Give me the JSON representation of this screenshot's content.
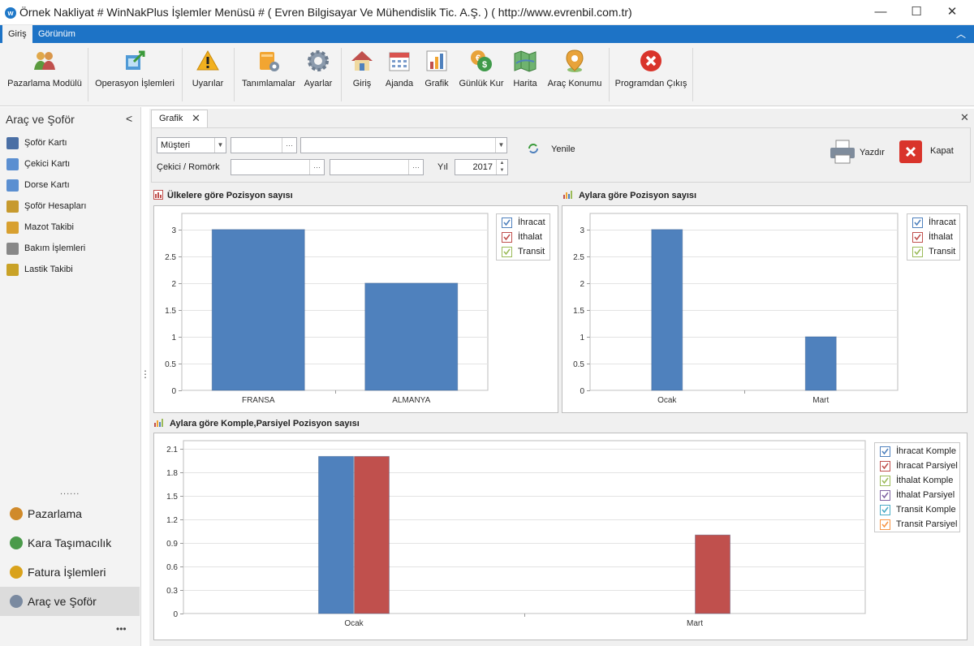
{
  "window": {
    "title": "Örnek Nakliyat # WinNakPlus İşlemler Menüsü #  ( Evren Bilgisayar Ve Mühendislik Tic. A.Ş. ) ( http://www.evrenbil.com.tr)",
    "app_icon_glyph": "w",
    "minimize": "—",
    "maximize": "☐",
    "close": "✕"
  },
  "ribbon": {
    "tabs": [
      "Giriş",
      "Görünüm"
    ],
    "collapse_glyph": "︿",
    "buttons": [
      {
        "label": "Pazarlama Modülü",
        "icon": "users-icon"
      },
      {
        "label": "Operasyon İşlemleri",
        "icon": "export-icon"
      },
      {
        "label": "Uyarılar",
        "icon": "warning-icon"
      },
      {
        "label": "Tanımlamalar",
        "icon": "definitions-icon"
      },
      {
        "label": "Ayarlar",
        "icon": "gear-icon"
      },
      {
        "label": "Giriş",
        "icon": "home-icon"
      },
      {
        "label": "Ajanda",
        "icon": "calendar-icon"
      },
      {
        "label": "Grafik",
        "icon": "chart-icon"
      },
      {
        "label": "Günlük Kur",
        "icon": "currency-icon"
      },
      {
        "label": "Harita",
        "icon": "map-icon"
      },
      {
        "label": "Araç Konumu",
        "icon": "location-pin-icon"
      },
      {
        "label": "Programdan Çıkış",
        "icon": "exit-icon"
      }
    ]
  },
  "left_panel": {
    "title": "Araç ve Şoför",
    "collapse_glyph": "<",
    "items": [
      {
        "label": "Şoför Kartı",
        "color": "#4a6fa5"
      },
      {
        "label": "Çekici Kartı",
        "color": "#5b8fd1"
      },
      {
        "label": "Dorse Kartı",
        "color": "#5b8fd1"
      },
      {
        "label": "Şoför Hesapları",
        "color": "#c79a2e"
      },
      {
        "label": "Mazot Takibi",
        "color": "#d8a030"
      },
      {
        "label": "Bakım İşlemleri",
        "color": "#888888"
      },
      {
        "label": "Lastik Takibi",
        "color": "#c9a227"
      }
    ],
    "splitter_dots": "......",
    "splitter_grip": "⋮",
    "nav": [
      {
        "label": "Pazarlama",
        "color": "#d08a2a"
      },
      {
        "label": "Kara Taşımacılık",
        "color": "#4a9a4a"
      },
      {
        "label": "Fatura İşlemleri",
        "color": "#d9a21b"
      },
      {
        "label": "Araç ve Şoför",
        "color": "#7a8aa0"
      }
    ],
    "more_glyph": "•••"
  },
  "document": {
    "tab_label": "Grafik",
    "tab_close": "✕",
    "close_all": "✕"
  },
  "filters": {
    "customer_combo": "Müşteri",
    "dropdown_glyph": "▼",
    "ellipsis": "···",
    "vehicle_label": "Çekici / Romörk",
    "year_label": "Yıl",
    "year_value": "2017",
    "refresh_label": "Yenile",
    "print_label": "Yazdır",
    "close_label": "Kapat"
  },
  "charts": {
    "country": {
      "title": "Ülkelere göre Pozisyon sayısı",
      "legend": [
        {
          "name": "İhracat",
          "color": "#4f81bd"
        },
        {
          "name": "İthalat",
          "color": "#c0504d"
        },
        {
          "name": "Transit",
          "color": "#9bbb59"
        }
      ]
    },
    "month": {
      "title": "Aylara göre Pozisyon sayısı",
      "legend": [
        {
          "name": "İhracat",
          "color": "#4f81bd"
        },
        {
          "name": "İthalat",
          "color": "#c0504d"
        },
        {
          "name": "Transit",
          "color": "#9bbb59"
        }
      ]
    },
    "split": {
      "title": "Aylara göre Komple,Parsiyel Pozisyon sayısı",
      "legend": [
        {
          "name": "İhracat Komple",
          "color": "#4f81bd"
        },
        {
          "name": "İhracat Parsiyel",
          "color": "#c0504d"
        },
        {
          "name": "İthalat Komple",
          "color": "#9bbb59"
        },
        {
          "name": "İthalat Parsiyel",
          "color": "#8064a2"
        },
        {
          "name": "Transit Komple",
          "color": "#4bacc6"
        },
        {
          "name": "Transit Parsiyel",
          "color": "#f79646"
        }
      ]
    }
  },
  "chart_data": [
    {
      "type": "bar",
      "title": "Ülkelere göre Pozisyon sayısı",
      "categories": [
        "FRANSA",
        "ALMANYA"
      ],
      "series": [
        {
          "name": "İhracat",
          "values": [
            3,
            2
          ],
          "color": "#4f81bd"
        }
      ],
      "yticks": [
        "0",
        "0.5",
        "1",
        "1.5",
        "2",
        "2.5",
        "3"
      ],
      "ylim": [
        0,
        3.3
      ],
      "grid": true,
      "legend_position": "top-right"
    },
    {
      "type": "bar",
      "title": "Aylara göre Pozisyon sayısı",
      "categories": [
        "Ocak",
        "Mart"
      ],
      "series": [
        {
          "name": "İhracat",
          "values": [
            3,
            1
          ],
          "color": "#4f81bd"
        }
      ],
      "yticks": [
        "0",
        "0.5",
        "1",
        "1.5",
        "2",
        "2.5",
        "3"
      ],
      "ylim": [
        0,
        3.3
      ],
      "grid": true,
      "legend_position": "top-right"
    },
    {
      "type": "bar",
      "title": "Aylara göre Komple,Parsiyel Pozisyon sayısı",
      "categories": [
        "Ocak",
        "Mart"
      ],
      "series": [
        {
          "name": "İhracat Komple",
          "values": [
            2,
            0
          ],
          "color": "#4f81bd"
        },
        {
          "name": "İhracat Parsiyel",
          "values": [
            2,
            1
          ],
          "color": "#c0504d"
        }
      ],
      "yticks": [
        "0",
        "0.3",
        "0.6",
        "0.9",
        "1.2",
        "1.5",
        "1.8",
        "2.1"
      ],
      "ylim": [
        0,
        2.2
      ],
      "grid": true,
      "legend_position": "top-right"
    }
  ]
}
